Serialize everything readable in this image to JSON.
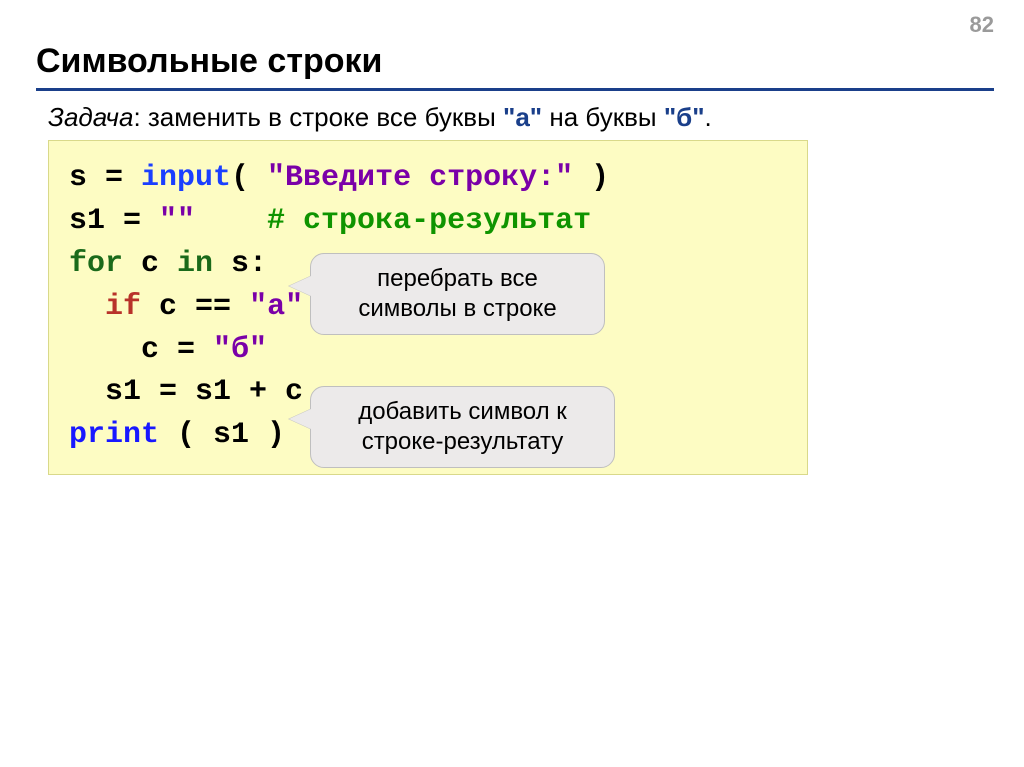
{
  "page_number": "82",
  "title": "Символьные строки",
  "task": {
    "label": "Задача",
    "text1": ": заменить в строке все буквы ",
    "quote_a": "\"а\"",
    "text2": " на буквы ",
    "quote_b": "\"б\"",
    "text3": "."
  },
  "code": {
    "line1": {
      "a": "s = ",
      "b": "input",
      "c": "( ",
      "d": "\"Введите строку:\"",
      "e": " )"
    },
    "line2": {
      "a": "s1 = ",
      "b": "\"\"",
      "c": "    ",
      "d": "# строка-результат"
    },
    "line3": {
      "a": "for",
      "b": " c ",
      "c": "in",
      "d": " s:"
    },
    "line4": {
      "a": "  ",
      "b": "if",
      "c": " c == ",
      "d": "\"а\"",
      "e": ":"
    },
    "line5": {
      "a": "    c = ",
      "b": "\"б\""
    },
    "line6": {
      "a": "  s1 = s1 + c"
    },
    "line7": {
      "a": "print",
      "b": " ( s1 )"
    }
  },
  "callout1": {
    "row1": "перебрать все",
    "row2": "символы в строке"
  },
  "callout2": {
    "row1": "добавить символ к",
    "row2": "строке-результату"
  }
}
